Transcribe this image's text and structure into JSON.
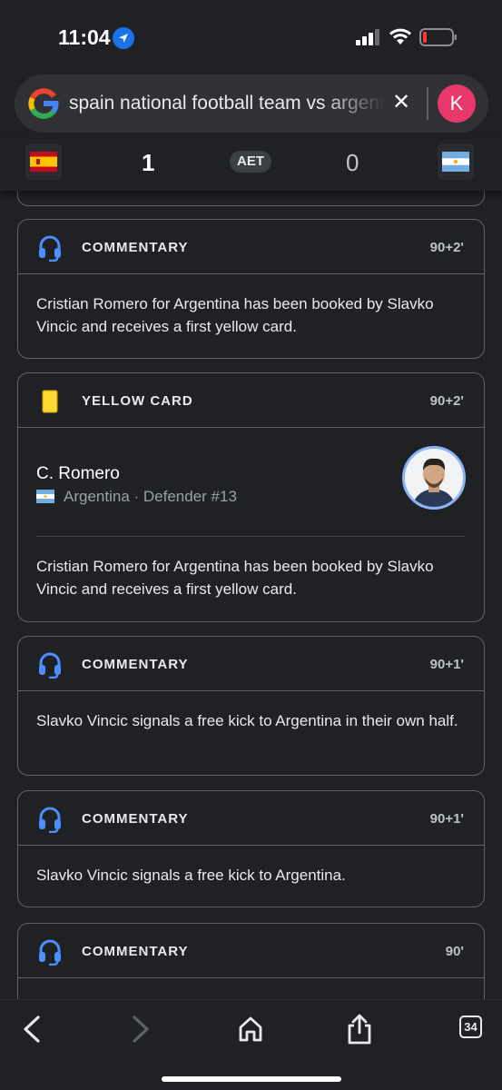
{
  "status_bar": {
    "time": "11:04"
  },
  "search": {
    "query": "spain national football team vs argentina",
    "account_initial": "K"
  },
  "scoreboard": {
    "home_score": "1",
    "status": "AET",
    "away_score": "0"
  },
  "colors": {
    "accent_blue": "#4a90ff",
    "yellow_card": "#fdd835",
    "avatar_pink": "#e8386b",
    "card_border": "#5f6368"
  },
  "feed": {
    "items": [
      {
        "type": "COMMENTARY",
        "minute": "90+2'",
        "text": "Cristian Romero for Argentina has been booked by Slavko Vincic and receives a first yellow card.",
        "icon": "headset-icon"
      },
      {
        "type": "YELLOW CARD",
        "minute": "90+2'",
        "player_name": "C. Romero",
        "player_meta": "Argentina · Defender #13",
        "text": "Cristian Romero for Argentina has been booked by Slavko Vincic and receives a first yellow card.",
        "icon": "yellow-card-icon"
      },
      {
        "type": "COMMENTARY",
        "minute": "90+1'",
        "text": "Slavko Vincic signals a free kick to Argentina in their own half.",
        "icon": "headset-icon"
      },
      {
        "type": "COMMENTARY",
        "minute": "90+1'",
        "text": "Slavko Vincic signals a free kick to Argentina.",
        "icon": "headset-icon"
      },
      {
        "type": "COMMENTARY",
        "minute": "90'",
        "icon": "headset-icon"
      }
    ]
  },
  "toolbar": {
    "tabs_count": "34"
  }
}
